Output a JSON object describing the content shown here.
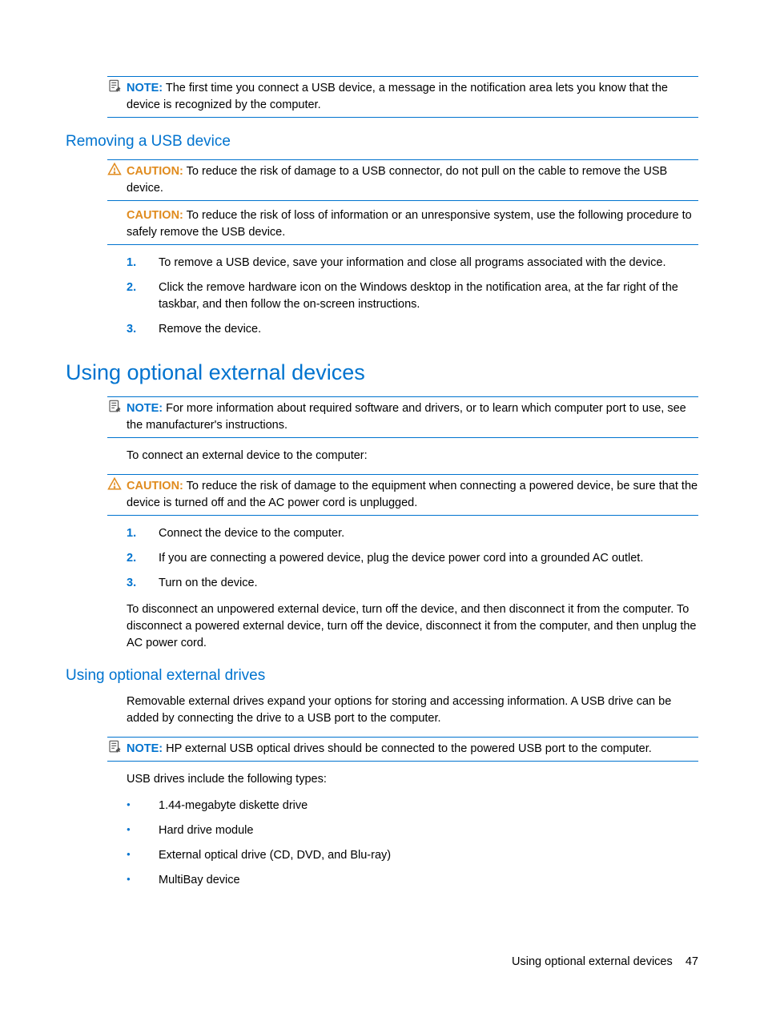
{
  "note1": {
    "label": "NOTE:",
    "text": "The first time you connect a USB device, a message in the notification area lets you know that the device is recognized by the computer."
  },
  "section_removing": {
    "heading": "Removing a USB device",
    "caution1": {
      "label": "CAUTION:",
      "text": "To reduce the risk of damage to a USB connector, do not pull on the cable to remove the USB device."
    },
    "caution2": {
      "label": "CAUTION:",
      "text": "To reduce the risk of loss of information or an unresponsive system, use the following procedure to safely remove the USB device."
    },
    "steps": [
      {
        "num": "1.",
        "text": "To remove a USB device, save your information and close all programs associated with the device."
      },
      {
        "num": "2.",
        "text": "Click the remove hardware icon on the Windows desktop in the notification area, at the far right of the taskbar, and then follow the on-screen instructions."
      },
      {
        "num": "3.",
        "text": "Remove the device."
      }
    ]
  },
  "section_optional": {
    "heading": "Using optional external devices",
    "note": {
      "label": "NOTE:",
      "text": "For more information about required software and drivers, or to learn which computer port to use, see the manufacturer's instructions."
    },
    "intro": "To connect an external device to the computer:",
    "caution": {
      "label": "CAUTION:",
      "text": "To reduce the risk of damage to the equipment when connecting a powered device, be sure that the device is turned off and the AC power cord is unplugged."
    },
    "steps": [
      {
        "num": "1.",
        "text": "Connect the device to the computer."
      },
      {
        "num": "2.",
        "text": "If you are connecting a powered device, plug the device power cord into a grounded AC outlet."
      },
      {
        "num": "3.",
        "text": "Turn on the device."
      }
    ],
    "outro": "To disconnect an unpowered external device, turn off the device, and then disconnect it from the computer. To disconnect a powered external device, turn off the device, disconnect it from the computer, and then unplug the AC power cord."
  },
  "section_drives": {
    "heading": "Using optional external drives",
    "intro": "Removable external drives expand your options for storing and accessing information. A USB drive can be added by connecting the drive to a USB port to the computer.",
    "note": {
      "label": "NOTE:",
      "text": "HP external USB optical drives should be connected to the powered USB port to the computer."
    },
    "list_intro": "USB drives include the following types:",
    "bullets": [
      "1.44-megabyte diskette drive",
      "Hard drive module",
      "External optical drive (CD, DVD, and Blu-ray)",
      "MultiBay device"
    ]
  },
  "footer": {
    "title": "Using optional external devices",
    "page": "47"
  }
}
